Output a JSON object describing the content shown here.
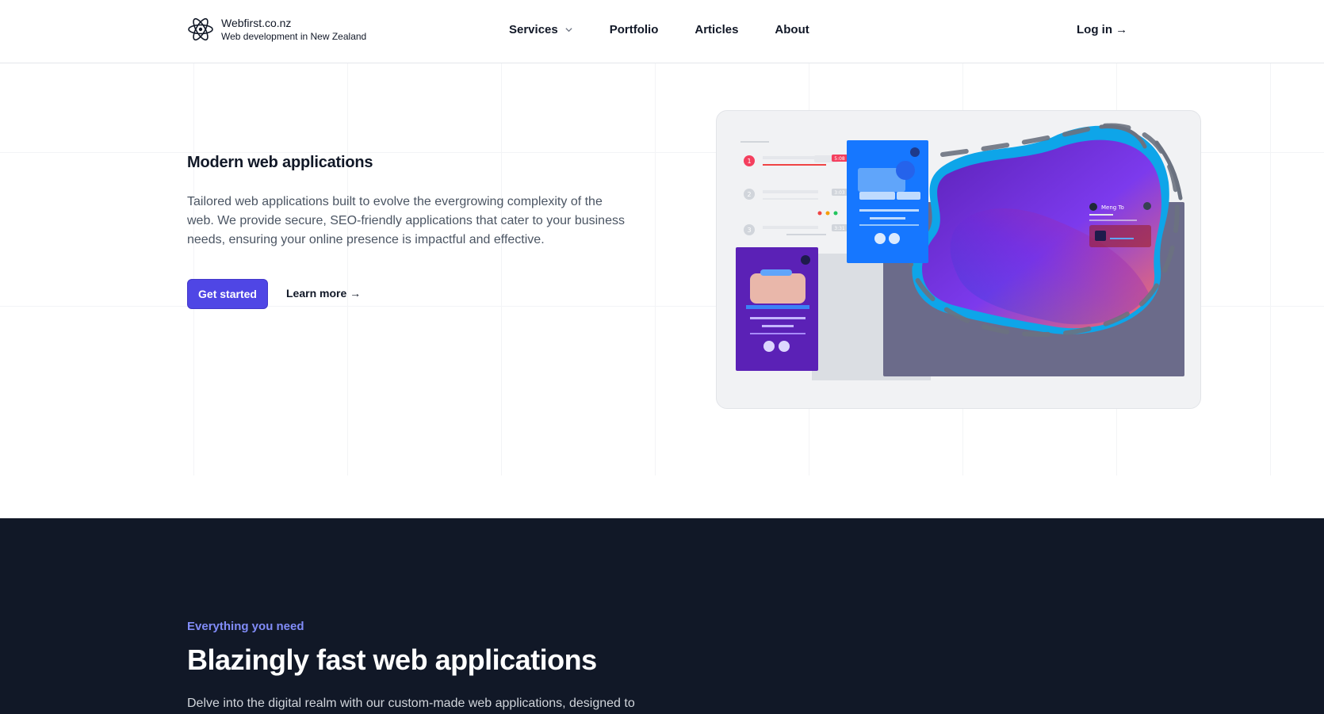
{
  "header": {
    "brand_name": "Webfirst.co.nz",
    "brand_tagline": "Web development in New Zealand",
    "nav": [
      {
        "label": "Services",
        "has_dropdown": true
      },
      {
        "label": "Portfolio"
      },
      {
        "label": "Articles"
      },
      {
        "label": "About"
      }
    ],
    "login_label": "Log in →"
  },
  "hero": {
    "title": "Modern web applications",
    "description": "Tailored web applications built to evolve the evergrowing complexity of the web. We provide secure, SEO-friendly applications that cater to your business needs, ensuring your online presence is impactful and effective.",
    "primary_button": "Get started",
    "secondary_link": "Learn more →",
    "illustration": {
      "list_times": [
        "5:08",
        "3:03",
        "3:31"
      ],
      "list_numbers": [
        "1",
        "2",
        "3"
      ],
      "profile_name": "Meng To"
    }
  },
  "features": {
    "eyebrow": "Everything you need",
    "title": "Blazingly fast web applications",
    "description": "Delve into the digital realm with our custom-made web applications, designed to"
  },
  "colors": {
    "accent": "#4f46e5",
    "eyebrow": "#818cf8",
    "dark_bg": "#111827"
  }
}
